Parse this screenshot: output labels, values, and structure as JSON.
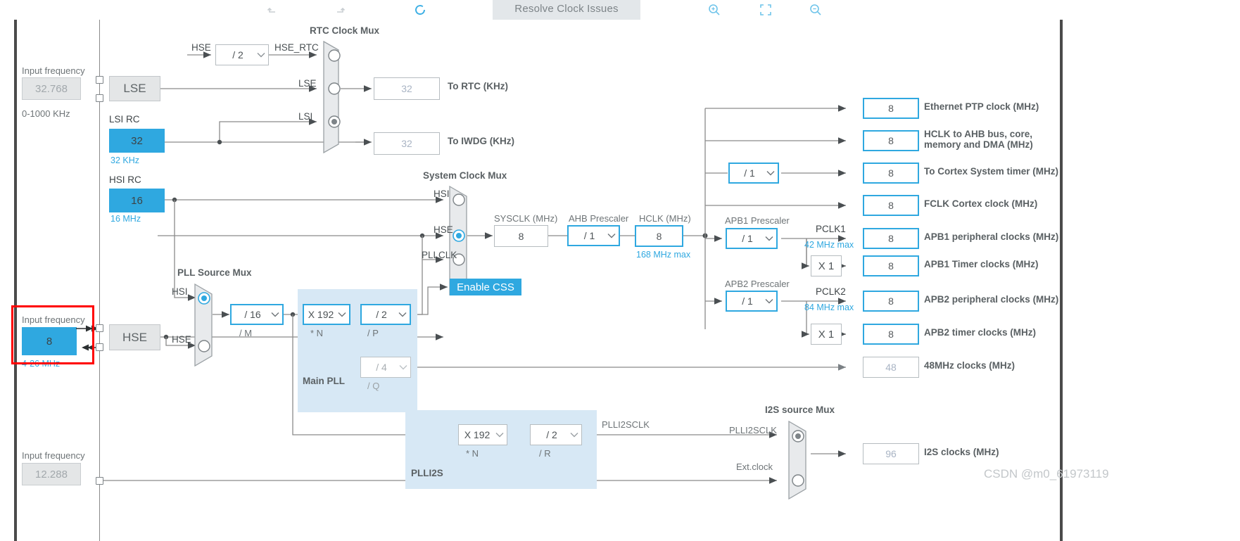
{
  "toolbar": {
    "undo_icon": "undo-icon",
    "redo_icon": "redo-icon",
    "refresh_icon": "refresh-icon",
    "resolve_label": "Resolve Clock Issues",
    "zoom_in_icon": "zoom-in-icon",
    "fit_icon": "fit-to-screen-icon",
    "zoom_out_icon": "zoom-out-icon"
  },
  "lse": {
    "input_frequency_label": "Input frequency",
    "input_frequency_value": "32.768",
    "range": "0-1000 KHz",
    "source_label": "LSE"
  },
  "hse_rtc_div": {
    "value": "/ 2",
    "in_label": "HSE",
    "out_label": "HSE_RTC"
  },
  "rtc_mux": {
    "title": "RTC Clock Mux",
    "inputs": [
      "HSE_RTC",
      "LSE",
      "LSI"
    ],
    "selected_index": 2
  },
  "rtc_out": {
    "value": "32",
    "label": "To RTC (KHz)"
  },
  "iwdg_out": {
    "value": "32",
    "label": "To IWDG (KHz)"
  },
  "lsi_rc": {
    "title": "LSI RC",
    "value": "32",
    "unit": "32 KHz"
  },
  "hsi_rc": {
    "title": "HSI RC",
    "value": "16",
    "unit": "16 MHz"
  },
  "hse": {
    "input_frequency_label": "Input frequency",
    "input_frequency_value": "8",
    "range": "4-26 MHz",
    "source_label": "HSE"
  },
  "i2s_in": {
    "input_frequency_label": "Input frequency",
    "input_frequency_value": "12.288"
  },
  "pll_source_mux": {
    "title": "PLL Source Mux",
    "inputs": [
      "HSI",
      "HSE"
    ],
    "selected_index": 0
  },
  "main_pll": {
    "band_label": "Main PLL",
    "m": {
      "value": "/ 16",
      "sub": "/ M"
    },
    "n": {
      "value": "X 192",
      "sub": "* N"
    },
    "p": {
      "value": "/ 2",
      "sub": "/ P"
    },
    "q": {
      "value": "/ 4",
      "sub": "/ Q"
    }
  },
  "system_clock_mux": {
    "title": "System Clock Mux",
    "inputs": [
      "HSI",
      "HSE",
      "PLLCLK"
    ],
    "selected_index": 1
  },
  "css": {
    "label": "Enable CSS"
  },
  "sysclk": {
    "label": "SYSCLK (MHz)",
    "value": "8"
  },
  "ahb_prescaler": {
    "label": "AHB Prescaler",
    "value": "/ 1"
  },
  "hclk": {
    "label": "HCLK (MHz)",
    "value": "8",
    "max": "168 MHz max"
  },
  "cortex_prescaler": {
    "value": "/ 1"
  },
  "apb1": {
    "prescaler_label": "APB1 Prescaler",
    "prescaler_value": "/ 1",
    "pclk_label": "PCLK1",
    "pclk_max": "42 MHz max",
    "timer_mult": "X 1"
  },
  "apb2": {
    "prescaler_label": "APB2 Prescaler",
    "prescaler_value": "/ 1",
    "pclk_label": "PCLK2",
    "pclk_max": "84 MHz max",
    "timer_mult": "X 1"
  },
  "outputs": [
    {
      "value": "8",
      "label": "Ethernet PTP clock (MHz)",
      "style": "blue"
    },
    {
      "value": "8",
      "label": "HCLK to AHB bus, core,\nmemory and DMA (MHz)",
      "style": "blue"
    },
    {
      "value": "8",
      "label": "To Cortex System timer (MHz)",
      "style": "blue"
    },
    {
      "value": "8",
      "label": "FCLK Cortex clock (MHz)",
      "style": "blue"
    },
    {
      "value": "8",
      "label": "APB1 peripheral clocks (MHz)",
      "style": "blue"
    },
    {
      "value": "8",
      "label": "APB1 Timer clocks (MHz)",
      "style": "blue"
    },
    {
      "value": "8",
      "label": "APB2 peripheral clocks (MHz)",
      "style": "blue"
    },
    {
      "value": "8",
      "label": "APB2 timer clocks (MHz)",
      "style": "blue"
    },
    {
      "value": "48",
      "label": "48MHz clocks (MHz)",
      "style": "gray"
    },
    {
      "value": "96",
      "label": "I2S clocks (MHz)",
      "style": "gray"
    }
  ],
  "plli2s": {
    "band_label": "PLLI2S",
    "n": {
      "value": "X 192",
      "sub": "* N"
    },
    "r": {
      "value": "/ 2",
      "sub": "/ R"
    },
    "out_label": "PLLI2SCLK"
  },
  "i2s_mux": {
    "title": "I2S source Mux",
    "inputs": [
      "PLLI2SCLK",
      "Ext.clock"
    ],
    "selected_index": 0
  },
  "watermark": "CSDN @m0_61973119",
  "colors": {
    "accent": "#2fa8e0",
    "band": "#d7e8f5",
    "wire": "#8a8a8a",
    "highlight": "#ff0000",
    "muted": "#a9b4c4"
  }
}
